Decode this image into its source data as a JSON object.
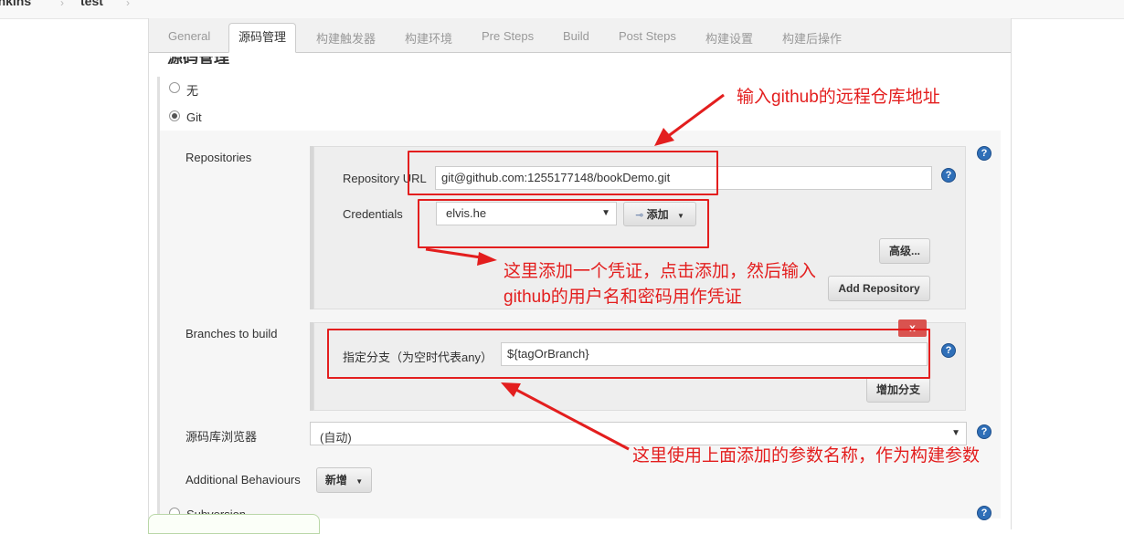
{
  "breadcrumb": {
    "root": "Jenkins",
    "job": "test"
  },
  "tabs": [
    "General",
    "源码管理",
    "构建触发器",
    "构建环境",
    "Pre Steps",
    "Build",
    "Post Steps",
    "构建设置",
    "构建后操作"
  ],
  "section_title": "源码管理",
  "scm": {
    "none_label": "无",
    "git_label": "Git",
    "subversion_label": "Subversion"
  },
  "repositories": {
    "label": "Repositories",
    "url_label": "Repository URL",
    "url_value": "git@github.com:1255177148/bookDemo.git",
    "credentials_label": "Credentials",
    "credentials_value": "elvis.he",
    "add_button": "添加",
    "advanced_button": "高级...",
    "add_repository_button": "Add Repository"
  },
  "branches": {
    "label": "Branches to build",
    "specifier_label": "指定分支（为空时代表any）",
    "specifier_value": "${tagOrBranch}",
    "delete_glyph": "x",
    "add_branch_button": "增加分支"
  },
  "browser": {
    "label": "源码库浏览器",
    "value": "(自动)"
  },
  "behaviours": {
    "label": "Additional Behaviours",
    "add_button": "新增"
  },
  "help_glyph": "?",
  "annotations": {
    "repo_url": "输入github的远程仓库地址",
    "credentials_line1": "这里添加一个凭证，点击添加，然后输入",
    "credentials_line2": "github的用户名和密码用作凭证",
    "branch": "这里使用上面添加的参数名称，作为构建参数"
  },
  "colors": {
    "annotation_red": "#e31e1e",
    "help_blue": "#2f6fb8",
    "delete_red": "#d9534f"
  }
}
